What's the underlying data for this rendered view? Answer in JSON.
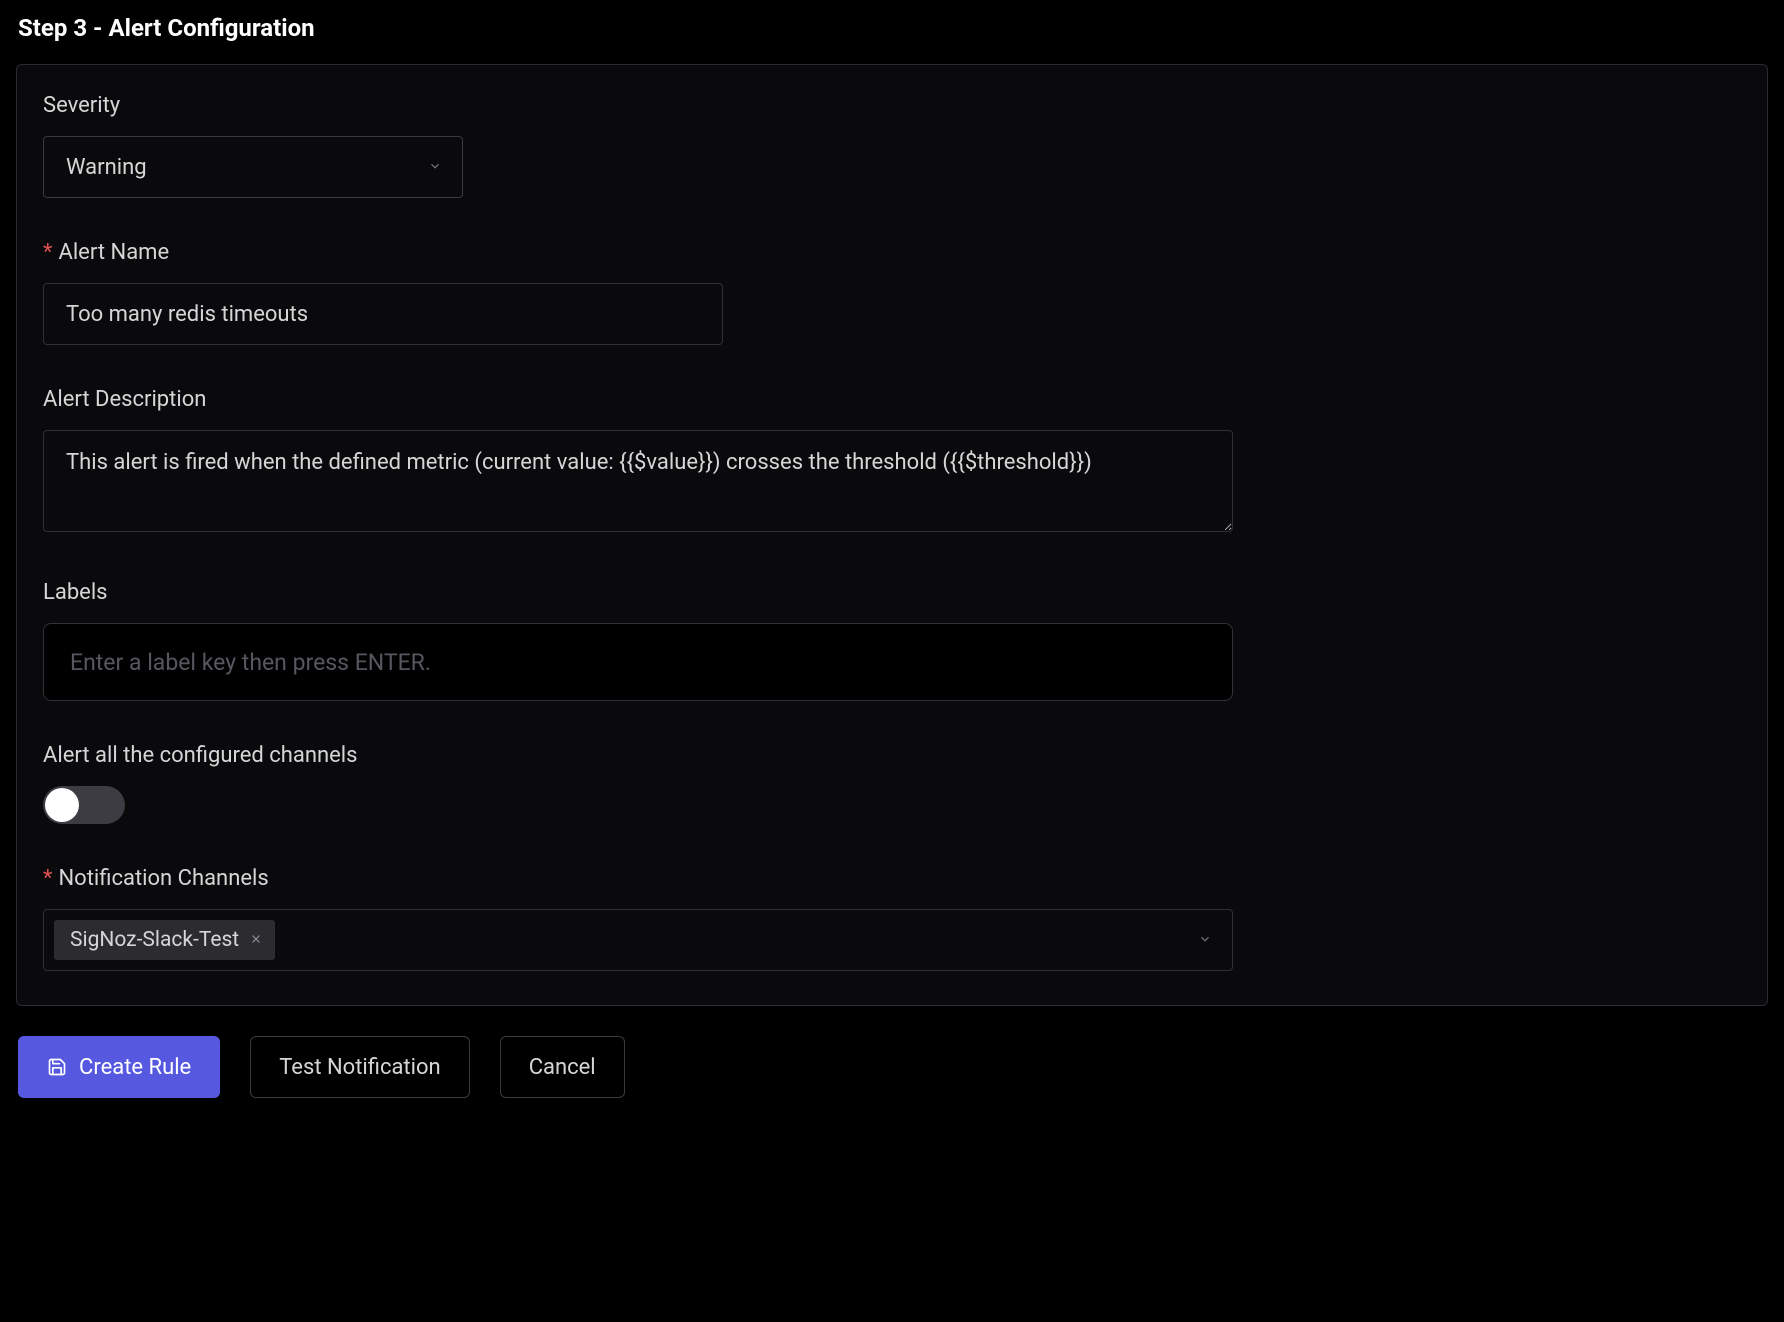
{
  "step_title": "Step 3 - Alert Configuration",
  "severity": {
    "label": "Severity",
    "value": "Warning"
  },
  "alert_name": {
    "label": "Alert Name",
    "value": "Too many redis timeouts"
  },
  "alert_description": {
    "label": "Alert Description",
    "value": "This alert is fired when the defined metric (current value: {{$value}}) crosses the threshold ({{$threshold}})"
  },
  "labels": {
    "label": "Labels",
    "placeholder": "Enter a label key then press ENTER."
  },
  "alert_all_channels": {
    "label": "Alert all the configured channels",
    "on": false
  },
  "notification_channels": {
    "label": "Notification Channels",
    "selected": [
      {
        "name": "SigNoz-Slack-Test"
      }
    ]
  },
  "buttons": {
    "create": "Create Rule",
    "test": "Test Notification",
    "cancel": "Cancel"
  }
}
